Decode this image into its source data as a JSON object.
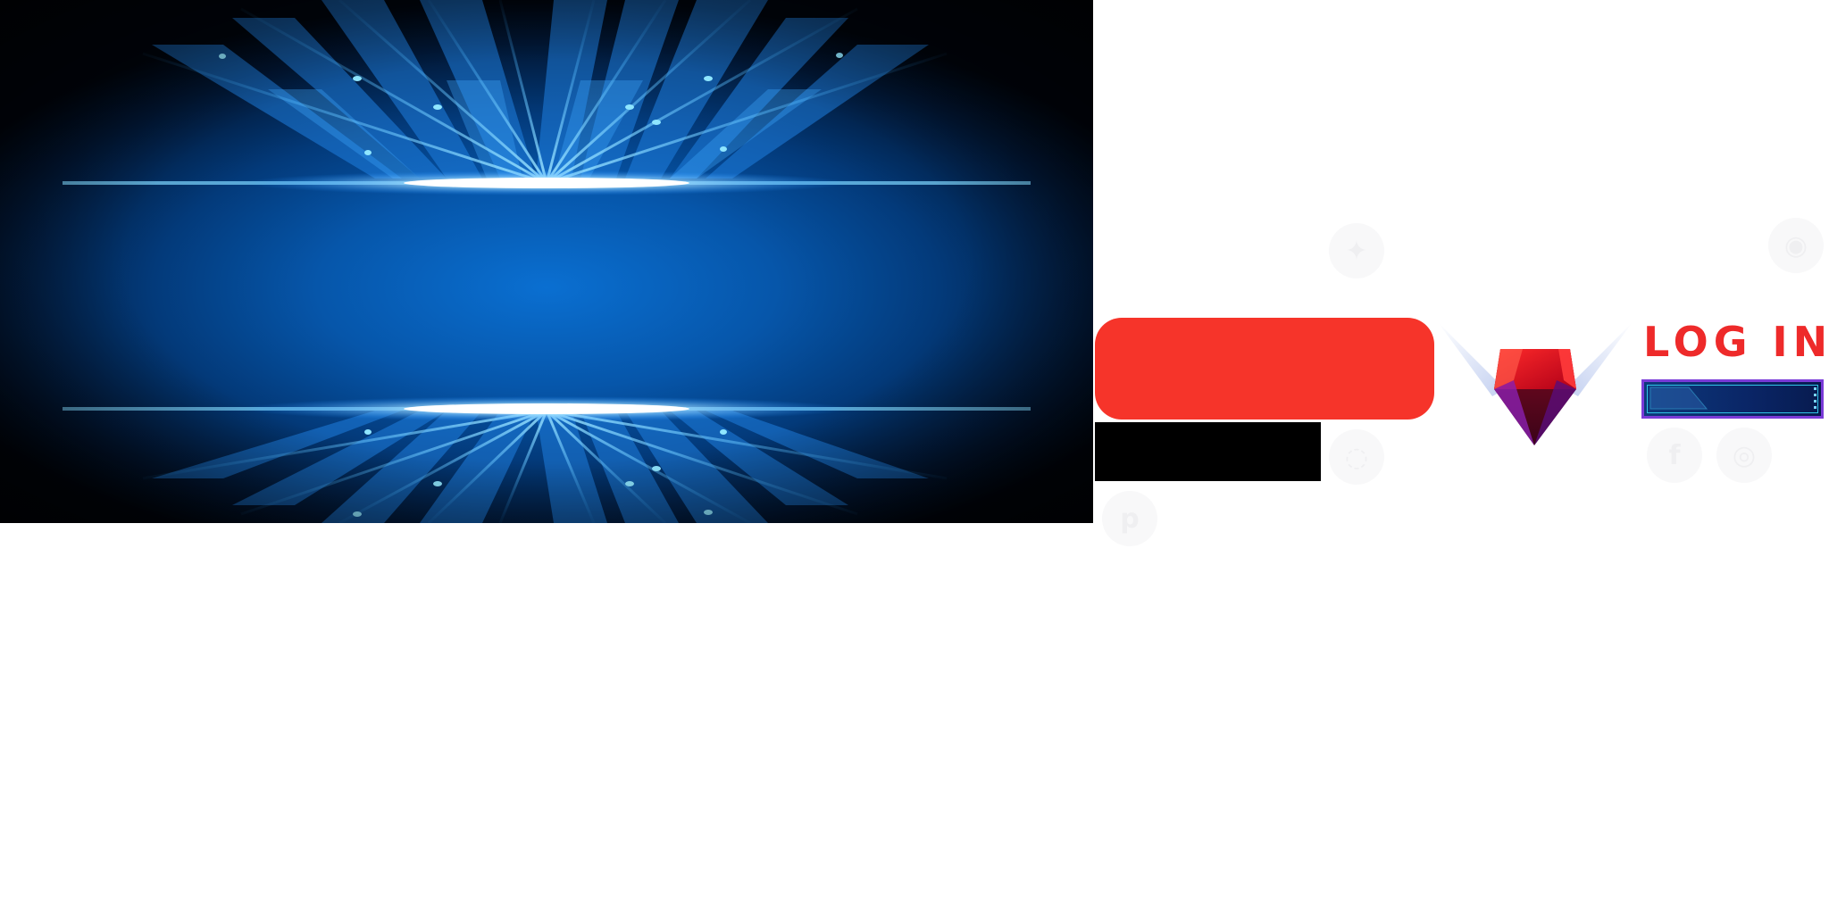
{
  "login": {
    "title": "LOG IN"
  },
  "icons": {
    "twitter": "twitter-icon",
    "chat": "chat-icon",
    "whatsapp": "whatsapp-icon",
    "facebook": "facebook-icon",
    "instagram": "instagram-icon",
    "pinterest": "pinterest-icon",
    "gem": "gem-logo-icon"
  },
  "colors": {
    "red_bar": "#f6342a",
    "black_bar": "#000000",
    "login_title": "#ee2a2a",
    "input_border": "#7a3bd8",
    "input_fill": "#0a2566",
    "banner_glow": "#0a6fd1"
  }
}
